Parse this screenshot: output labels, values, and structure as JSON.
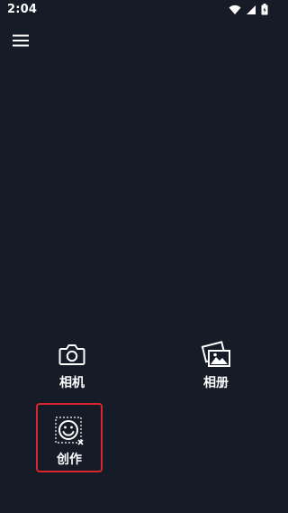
{
  "status_bar": {
    "time": "2:04",
    "icons": [
      "wifi-icon",
      "signal-icon",
      "battery-icon"
    ]
  },
  "header": {
    "menu_icon": "menu-icon"
  },
  "actions": [
    {
      "label": "相机",
      "icon": "camera-icon"
    },
    {
      "label": "相册",
      "icon": "album-icon"
    },
    {
      "label": "创作",
      "icon": "create-icon"
    }
  ],
  "colors": {
    "background": "#151b27",
    "highlight": "#d8262c",
    "foreground": "#ffffff"
  }
}
